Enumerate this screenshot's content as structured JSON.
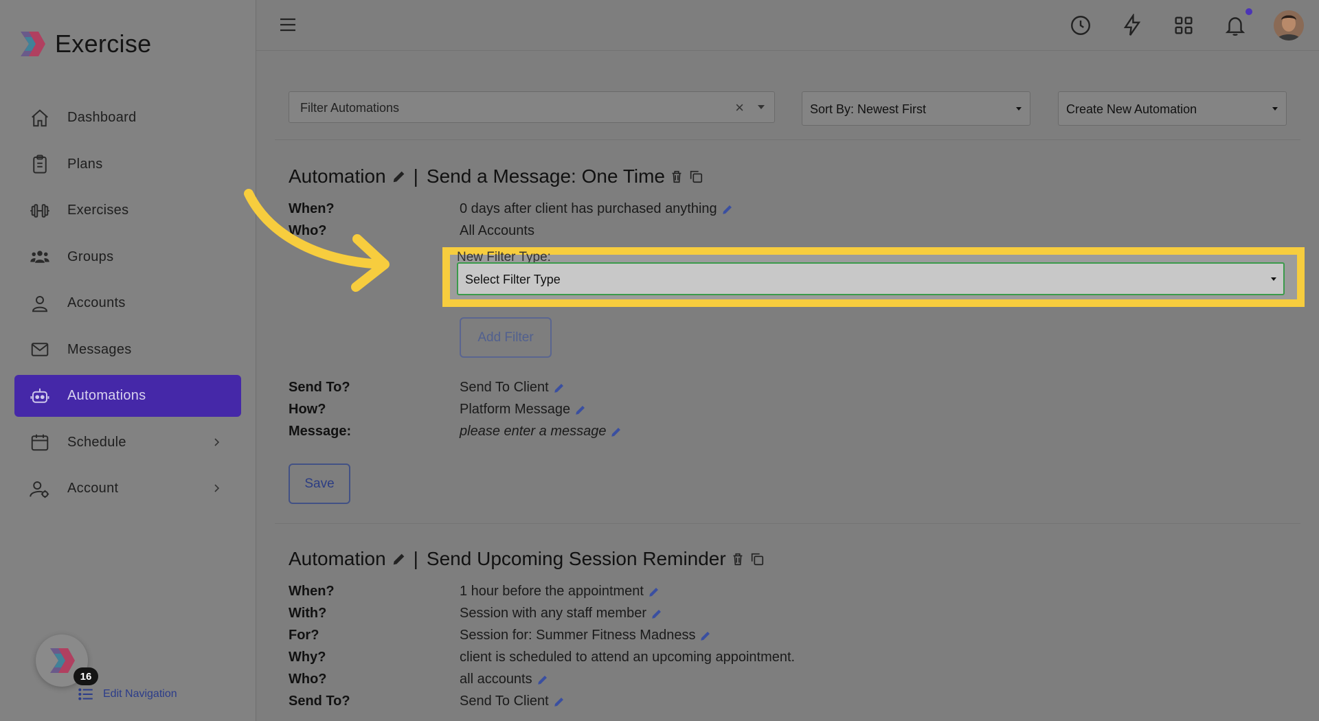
{
  "sidebar": {
    "brand": "Exercise",
    "items": [
      {
        "label": "Dashboard",
        "icon": "home-icon"
      },
      {
        "label": "Plans",
        "icon": "clipboard-icon"
      },
      {
        "label": "Exercises",
        "icon": "dumbbell-icon"
      },
      {
        "label": "Groups",
        "icon": "users-icon"
      },
      {
        "label": "Accounts",
        "icon": "user-icon"
      },
      {
        "label": "Messages",
        "icon": "envelope-icon"
      },
      {
        "label": "Automations",
        "icon": "robot-icon",
        "active": true
      },
      {
        "label": "Schedule",
        "icon": "calendar-icon",
        "has_submenu": true
      },
      {
        "label": "Account",
        "icon": "user-cog-icon",
        "has_submenu": true
      }
    ],
    "badge_count": "16",
    "edit_navigation": "Edit Navigation"
  },
  "toolbar": {
    "filter_placeholder": "Filter Automations",
    "clear_symbol": "×",
    "sort_label": "Sort By: Newest First",
    "create_label": "Create New Automation"
  },
  "automation1": {
    "prefix": "Automation",
    "separator": "|",
    "name": "Send a Message: One Time",
    "rows": [
      {
        "label": "When?",
        "value": "0 days after client has purchased anything"
      },
      {
        "label": "Who?",
        "value": "All Accounts"
      }
    ],
    "new_filter_label": "New Filter Type:",
    "filter_select_value": "Select Filter Type",
    "add_filter_label": "Add Filter",
    "rows2": [
      {
        "label": "Send To?",
        "value": "Send To Client"
      },
      {
        "label": "How?",
        "value": "Platform Message"
      },
      {
        "label": "Message:",
        "value": "please enter a message"
      }
    ],
    "save_label": "Save"
  },
  "automation2": {
    "prefix": "Automation",
    "separator": "|",
    "name": "Send Upcoming Session Reminder",
    "rows": [
      {
        "label": "When?",
        "value": "1 hour before the appointment"
      },
      {
        "label": "With?",
        "value": "Session with any staff member"
      },
      {
        "label": "For?",
        "value": "Session for: Summer Fitness Madness"
      },
      {
        "label": "Why?",
        "value": "client is scheduled to attend an upcoming appointment."
      },
      {
        "label": "Who?",
        "value": "all accounts"
      },
      {
        "label": "Send To?",
        "value": "Send To Client"
      }
    ]
  },
  "colors": {
    "active_nav": "#4528a8",
    "highlight": "#f7cd3e",
    "focus_border": "#3a9a4a",
    "link": "#2c3d83"
  }
}
